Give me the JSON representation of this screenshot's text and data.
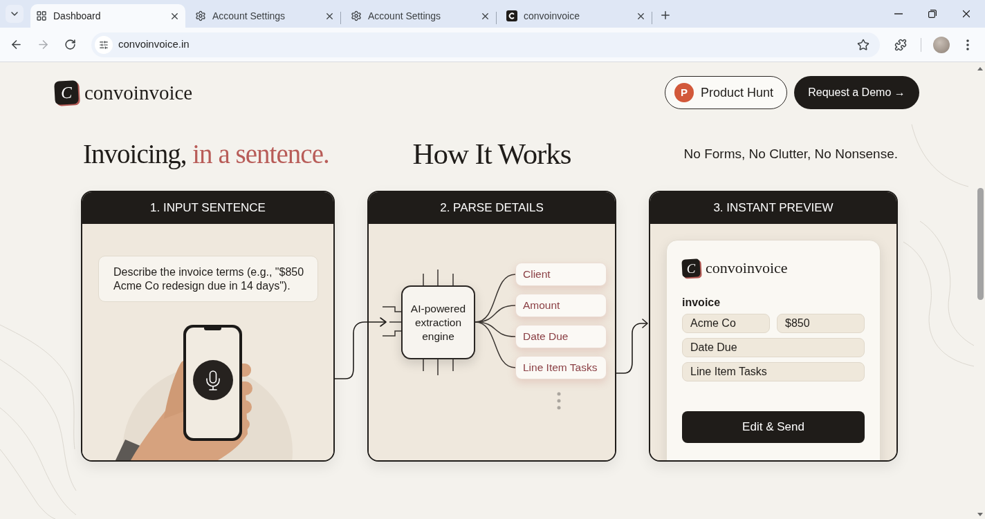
{
  "browser": {
    "tabs": [
      {
        "title": "Dashboard",
        "kind": "grid",
        "selected": true
      },
      {
        "title": "Account Settings",
        "kind": "gear",
        "selected": false
      },
      {
        "title": "Account Settings",
        "kind": "gear",
        "selected": false
      },
      {
        "title": "convoinvoice",
        "kind": "logo",
        "selected": false
      }
    ],
    "address": "convoinvoice.in"
  },
  "site_header": {
    "logo_mark": "C",
    "logo_text": "convoinvoice",
    "buttons": [
      {
        "kind": "outline",
        "badge": "P",
        "label": "Product Hunt"
      },
      {
        "kind": "solid",
        "label": "Request a Demo →"
      }
    ]
  },
  "headline": {
    "lead": "Invoicing,",
    "accent": "in a sentence."
  },
  "title": "How It Works",
  "slogan": "No Forms, No Clutter, No Nonsense.",
  "steps": [
    {
      "title": "1. INPUT SENTENCE",
      "kind": "input",
      "prompt": "Describe the invoice terms (e.g., \"$850 Acme Co redesign due in 14 days\")."
    },
    {
      "title": "2. PARSE DETAILS",
      "kind": "parse",
      "engine": "AI-powered extraction engine",
      "fields": [
        "Client",
        "Amount",
        "Date Due",
        "Line Item Tasks"
      ]
    },
    {
      "title": "3. INSTANT PREVIEW",
      "kind": "preview",
      "logo_mark": "C",
      "logo_text": "convoinvoice",
      "heading": "invoice",
      "rows": [
        [
          "Acme Co",
          "$850"
        ],
        [
          "Date Due"
        ],
        [
          "Line Item Tasks"
        ]
      ],
      "button": "Edit & Send"
    }
  ]
}
